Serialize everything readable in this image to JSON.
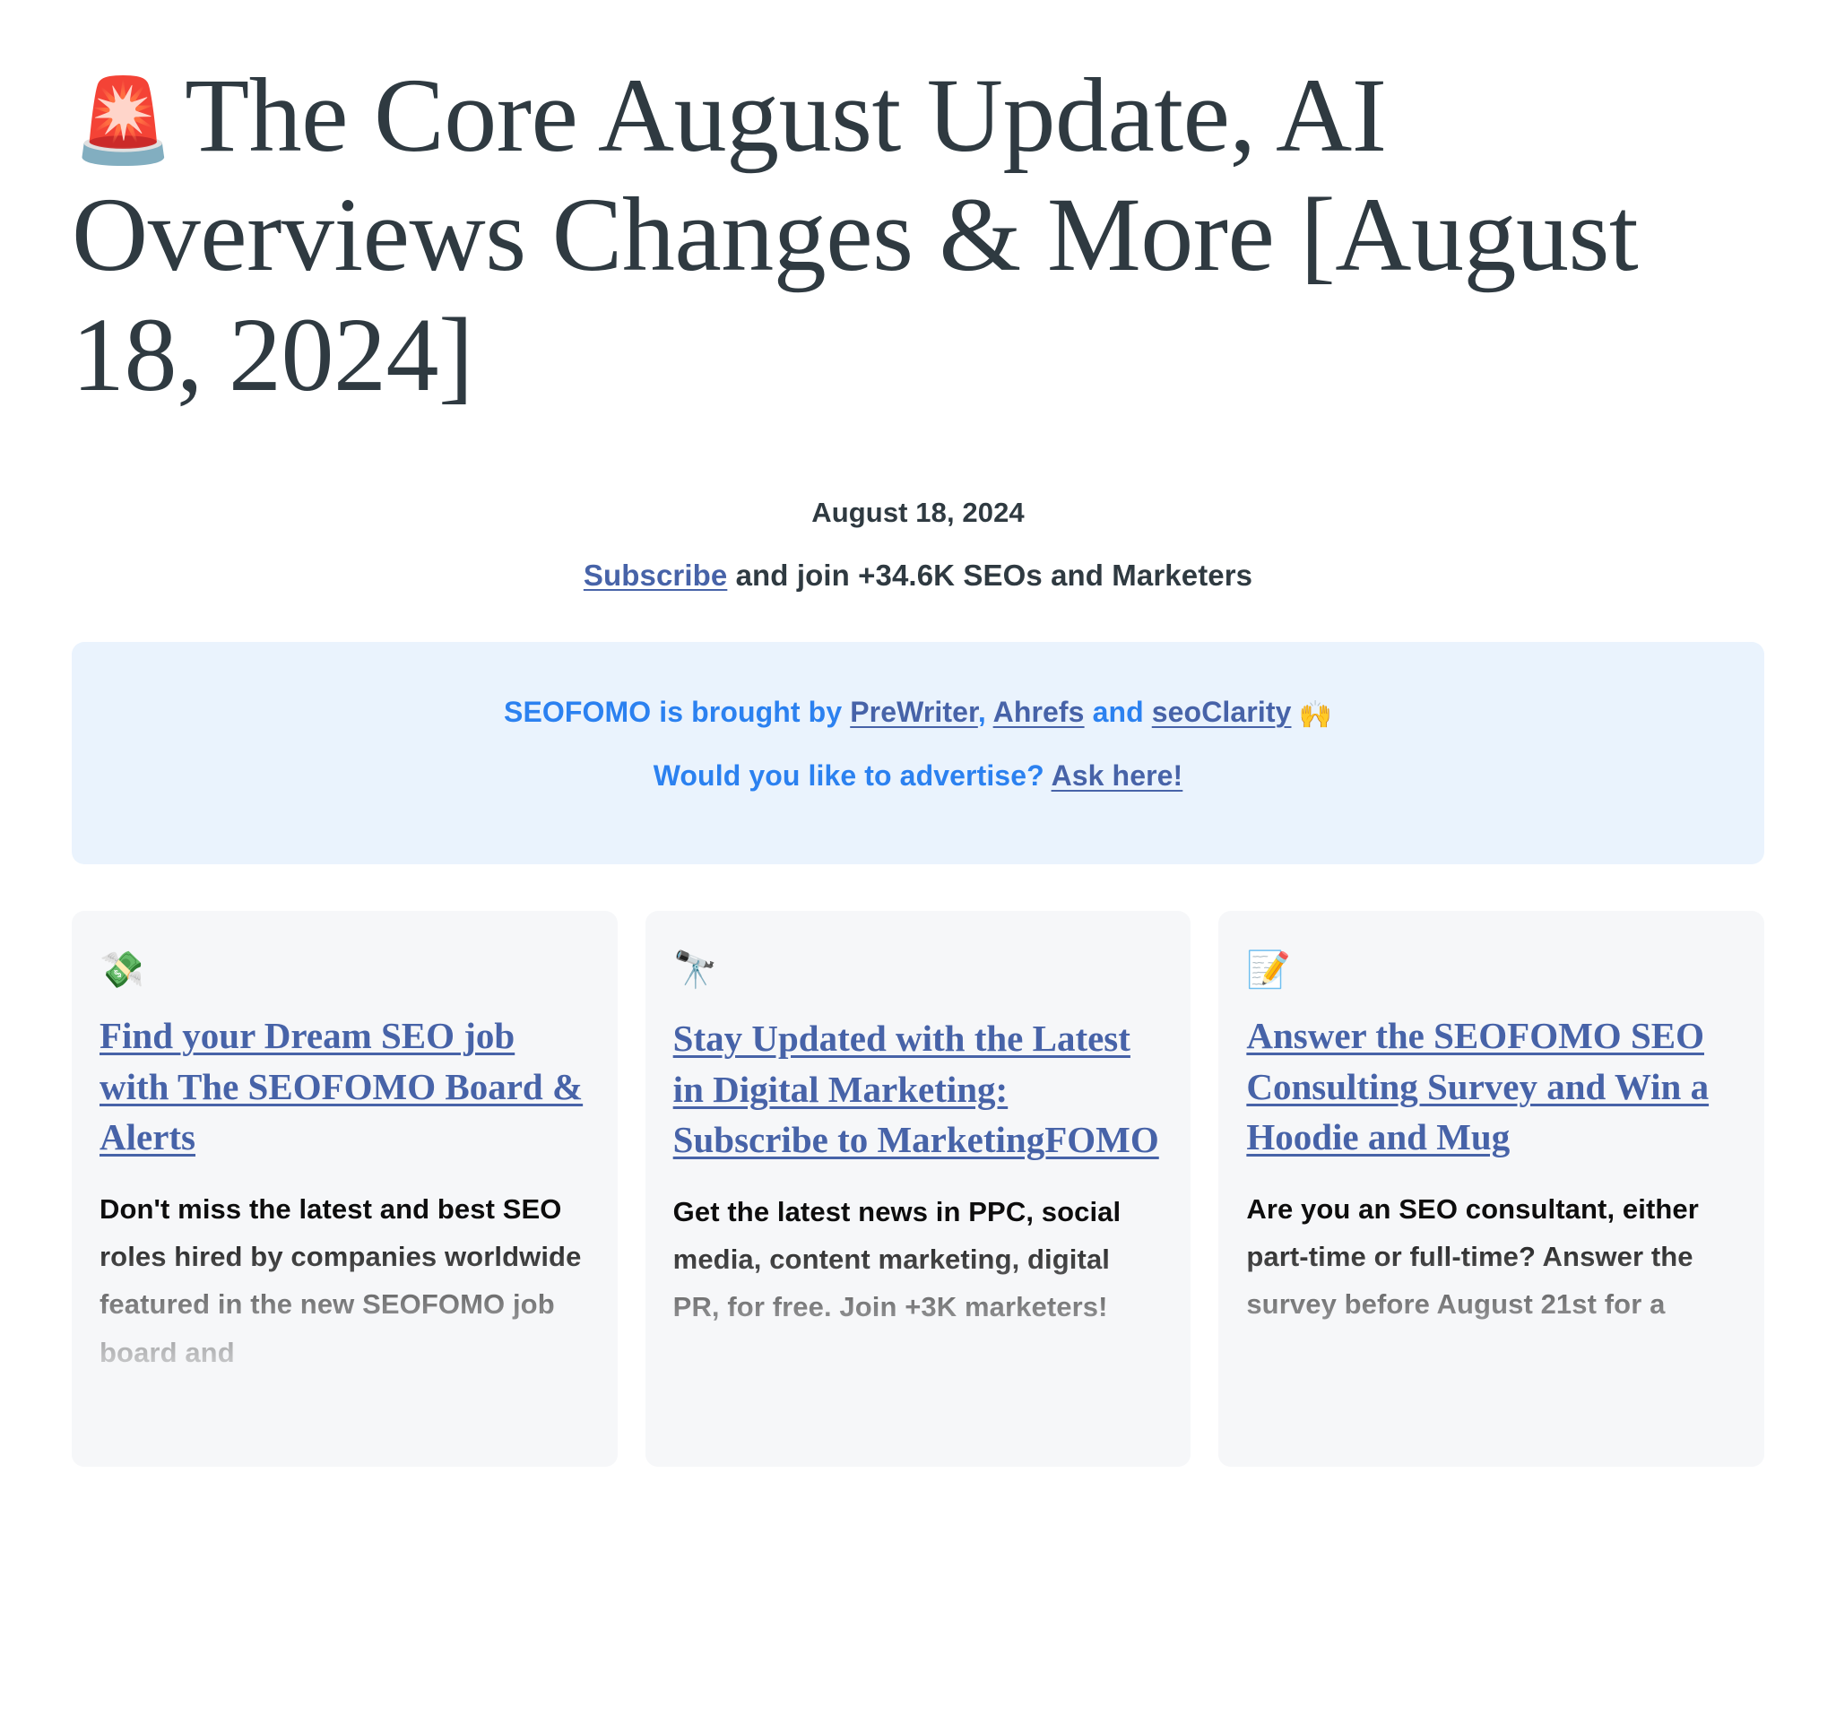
{
  "header": {
    "siren_icon": "🚨",
    "title": "The Core August Update, AI Overviews Changes & More [August 18, 2024]"
  },
  "meta": {
    "date": "August 18, 2024",
    "subscribe_link": "Subscribe",
    "subscribe_rest": " and join +34.6K SEOs and Marketers"
  },
  "banner": {
    "line1_prefix": "SEOFOMO is brought by ",
    "sponsor1": "PreWriter",
    "line1_sep1": ", ",
    "sponsor2": "Ahrefs",
    "line1_sep2": " and ",
    "sponsor3": "seoClarity",
    "hands_icon": "🙌",
    "line2_prefix": "Would you like to advertise? ",
    "ask_link": "Ask here!",
    "background_color": "#eaf3fd",
    "text_color": "#2b81f0",
    "link_color": "#4763a8"
  },
  "cards": [
    {
      "icon": "💸",
      "icon_name": "money-with-wings-icon",
      "title": "Find your Dream SEO job with The SEOFOMO Board & Alerts",
      "body": "Don't miss the latest and best SEO roles hired by companies worldwide featured in the new SEOFOMO job board and"
    },
    {
      "icon": "🔭",
      "icon_name": "telescope-icon",
      "title": "Stay Updated with the Latest in Digital Marketing: Subscribe to MarketingFOMO",
      "body": "Get the latest news in PPC, social media, content marketing, digital PR, for free. Join +3K marketers!"
    },
    {
      "icon": "📝",
      "icon_name": "memo-icon",
      "title": "Answer the SEOFOMO SEO Consulting Survey and Win a Hoodie and Mug",
      "body": "Are you an SEO consultant, either part-time or full-time? Answer the survey before August 21st for a"
    }
  ],
  "colors": {
    "title_text": "#2f3a41",
    "card_background": "#f6f7f9",
    "card_link": "#4763a8"
  }
}
